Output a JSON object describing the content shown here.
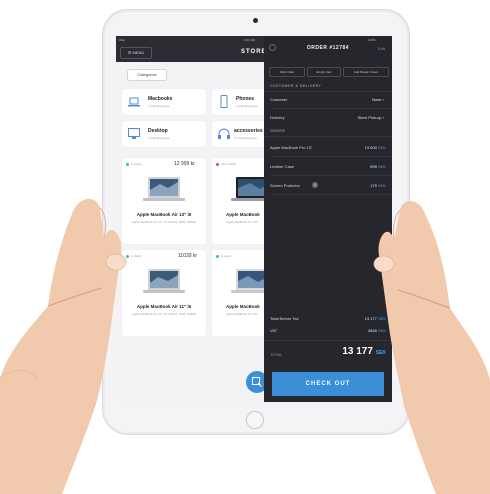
{
  "status_bar": {
    "left": "iPad",
    "time": "9:41 AM",
    "battery": "100%"
  },
  "store": {
    "menu_label": "MENU",
    "title": "STORE",
    "category_chip": "Categories",
    "categories": [
      {
        "name": "Macbooks",
        "subtitle": "4 subcategories",
        "icon": "laptop-icon"
      },
      {
        "name": "Phones",
        "subtitle": "6 subcategories",
        "icon": "phone-icon"
      },
      {
        "name": "Desktop",
        "subtitle": "3 subcategories",
        "icon": "desktop-icon"
      },
      {
        "name": "accessories",
        "subtitle": "12 subcategories",
        "icon": "headphones-icon"
      }
    ],
    "products": [
      {
        "price": "12 999 kr",
        "name": "Apple MacBook Air 13\" i5",
        "desc": "Apple MacBook Air 13\", i5 1.8GHz, 8GB, 128GB",
        "stock": "in stock",
        "status_color": "#2ec4a0"
      },
      {
        "price": "",
        "name": "Apple MacBook",
        "desc": "Apple MacBook Pro 13\"",
        "stock": "not in stock",
        "status_color": "#e84848"
      },
      {
        "price": "11039 kr",
        "name": "Apple MacBook Air 11\" i5",
        "desc": "Apple MacBook Air 11\", i5 1.6GHz, 4GB, 128GB",
        "stock": "in stock",
        "status_color": "#2ec4a0"
      },
      {
        "price": "",
        "name": "Apple MacBook",
        "desc": "Apple MacBook Pro 15\"",
        "stock": "in stock",
        "status_color": "#2ec4a0"
      }
    ],
    "fab_icon": "scan-icon"
  },
  "order": {
    "title": "ORDER #12784",
    "edit": "Edit",
    "battery": "100%",
    "buttons": [
      "Park Order",
      "Empty Cart",
      "Add Rrade In Item"
    ],
    "customer_section": "CUSTOMER & DELIVERY",
    "customer_label": "Customer",
    "customer_value": "None",
    "delivery_label": "Delivery",
    "delivery_value": "Store Pick-up",
    "order_section": "ORDER",
    "items": [
      {
        "name": "Apple MacBook Pro 13\"",
        "amount": "13 000",
        "currency": "SEK"
      },
      {
        "name": "Leather Case",
        "amount": "999",
        "currency": "SEK"
      },
      {
        "name": "Screen Protector",
        "amount": "179",
        "currency": "SEK",
        "badge": "1"
      }
    ],
    "total_before_tax_label": "Total Before Tax",
    "total_before_tax_value": "13 177",
    "total_before_tax_currency": "SEK",
    "vat_label": "VAT",
    "vat_value": "2645",
    "vat_currency": "SEK",
    "total_label": "TOTAL",
    "total_value": "13 177",
    "total_currency": "SEK",
    "checkout_label": "CHECK OUT"
  },
  "colors": {
    "accent": "#3a8fd8",
    "panel": "#26262d",
    "topbar": "#2c2c34",
    "in_stock": "#2ec4a0",
    "out_stock": "#e84848"
  }
}
